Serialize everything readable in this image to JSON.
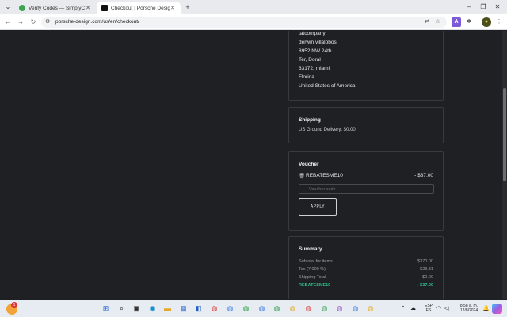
{
  "browser": {
    "tabs": [
      {
        "title": "Verify Codes — SimplyCodes",
        "active": false
      },
      {
        "title": "Checkout | Porsche Design",
        "active": true
      }
    ],
    "url": "porsche-design.com/us/en/checkout/"
  },
  "address": {
    "lines": [
      "tatcompany",
      "derwin villalobos",
      "8952 NW 24th",
      "Ter, Doral",
      "33172, miami",
      "Florida",
      "United States of America"
    ]
  },
  "shipping": {
    "title": "Shipping",
    "method": "US Ground Delivery: $0.00"
  },
  "voucher": {
    "title": "Voucher",
    "code": "REBATESME10",
    "amount": "- $37.00",
    "input_placeholder": "Voucher code",
    "apply_label": "APPLY"
  },
  "summary": {
    "title": "Summary",
    "rows": [
      {
        "label": "Subtotal for items",
        "value": "$370.00"
      },
      {
        "label": "Tax (7.000 %)",
        "value": "$23.31"
      },
      {
        "label": "Shipping Total",
        "value": "$0.00"
      },
      {
        "label": "REBATESME10",
        "value": "- $37.00"
      }
    ]
  },
  "taskbar": {
    "weather_badge": "1",
    "lang_top": "ESP",
    "lang_bottom": "ES",
    "time": "8:58 a. m.",
    "date": "12/8/2024"
  },
  "colors": {
    "page_bg": "#1f2023",
    "discount_green": "#2fbf8a",
    "card_border": "#393a3e"
  }
}
